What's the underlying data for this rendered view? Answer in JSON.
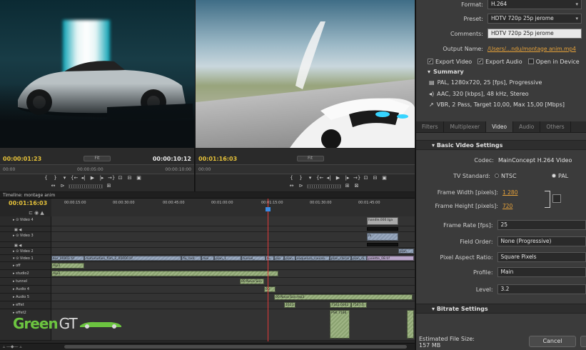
{
  "source_monitor": {
    "timecode_left": "00:00:01:23",
    "timecode_right": "00:00:10:12",
    "fit": "Fit",
    "ruler_left": "00:00",
    "ruler_mid": "00:00:05:00",
    "ruler_right": "00:00:10:00"
  },
  "program_monitor": {
    "timecode_left": "00:01:16:03",
    "fit": "Fit",
    "ruler_left": "00:00"
  },
  "timeline": {
    "tab": "Timeline: montage anim",
    "timecode": "00:01:16:03",
    "ticks": [
      "00:00:15:00",
      "00:00:30:00",
      "00:00:45:00",
      "00:01:00:00",
      "00:01:15:00",
      "00:01:30:00",
      "00:01:45:00"
    ],
    "tracks": [
      {
        "label": "Video 4"
      },
      {
        "label": "Video 3"
      },
      {
        "label": "Video 2"
      },
      {
        "label": "Video 1"
      },
      {
        "label": "off"
      },
      {
        "label": "studio2"
      },
      {
        "label": "tunnel"
      },
      {
        "label": "Audio 4"
      },
      {
        "label": "Audio 5"
      },
      {
        "label": "effet"
      },
      {
        "label": "effet2"
      }
    ],
    "clips": {
      "v4": "handle.000.tga",
      "v3": "fx",
      "v2": "plan",
      "v1a": "bar_00001.tif",
      "v1b": "motomotion_film_2_00000.tif",
      "v1c": "fix_mot",
      "v1d": "moi",
      "v1e": "plan_1",
      "v1f": "tunnel_",
      "v1g": "tu",
      "v1h": "plo",
      "v1i": "plan",
      "v1j": "sequence_course",
      "v1k": "plan_chicar",
      "v1l": "plan_di",
      "v1m": "palette_08.tif",
      "a_off": "mp3",
      "a_studio": "mp3",
      "a_tunnel": "00 Nova Sun",
      "a_a4": "00",
      "a_a5": "00 Nova Sun.mp3",
      "a_effet1": "1613",
      "a_effet2": "7162.0041",
      "a_effet3": "7567.0",
      "a_effet4": "PSK 7166"
    },
    "logo_green": "Green",
    "logo_white": "GT"
  },
  "export": {
    "format_label": "Format:",
    "format_value": "H.264",
    "preset_label": "Preset:",
    "preset_value": "HDTV 720p 25p jerome",
    "comments_label": "Comments:",
    "comments_value": "HDTV 720p 25p jerome",
    "output_label": "Output Name:",
    "output_value": "/Users/...ndu/montage anim.mp4",
    "export_video": "Export Video",
    "export_audio": "Export Audio",
    "open_in_device": "Open in Device",
    "summary": "Summary",
    "summary_video": "PAL, 1280x720, 25 [fps], Progressive",
    "summary_audio": "AAC, 320 [kbps], 48 kHz, Stereo",
    "summary_bitrate": "VBR, 2 Pass, Target 10,00, Max 15,00 [Mbps]",
    "tabs": [
      "Filters",
      "Multiplexer",
      "Video",
      "Audio",
      "Others"
    ],
    "active_tab": "Video",
    "basic_section": "Basic Video Settings",
    "codec_label": "Codec:",
    "codec_value": "MainConcept H.264 Video",
    "tv_label": "TV Standard:",
    "tv_ntsc": "NTSC",
    "tv_pal": "PAL",
    "width_label": "Frame Width [pixels]:",
    "width_value": "1 280",
    "height_label": "Frame Height [pixels]:",
    "height_value": "720",
    "rate_label": "Frame Rate [fps]:",
    "rate_value": "25",
    "field_label": "Field Order:",
    "field_value": "None (Progressive)",
    "par_label": "Pixel Aspect Ratio:",
    "par_value": "Square Pixels",
    "profile_label": "Profile:",
    "profile_value": "Main",
    "level_label": "Level:",
    "level_value": "3.2",
    "bitrate_section": "Bitrate Settings",
    "est_label": "Estimated File Size:",
    "est_value": "157 MB",
    "cancel": "Cancel"
  }
}
